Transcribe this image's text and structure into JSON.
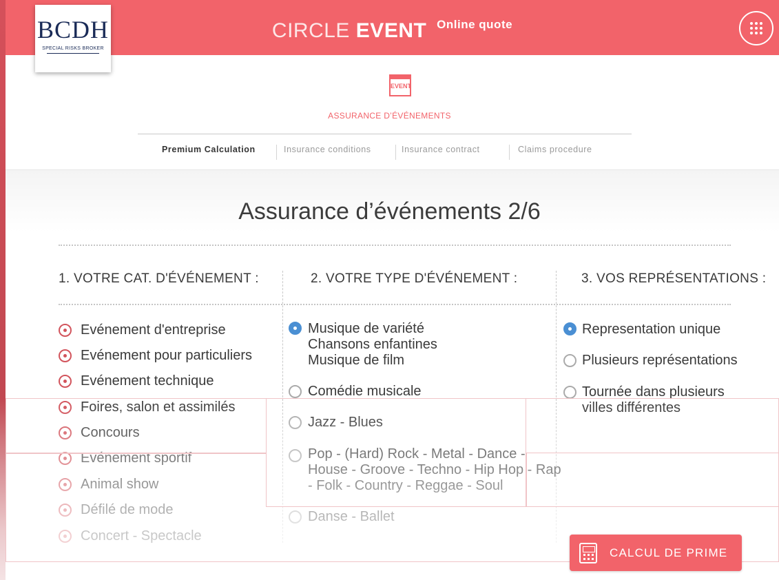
{
  "header": {
    "title_light": "CIRCLE",
    "title_bold": "EVENT",
    "subtitle": "Online quote",
    "menu_icon": "grid-dots-icon"
  },
  "logo": {
    "mark": "BCDH",
    "tagline": "SPECIAL RISKS BROKER"
  },
  "section": {
    "icon_label": "EVENT",
    "title": "ASSURANCE D’ÉVÉNEMENTS"
  },
  "nav": {
    "tabs": [
      {
        "label": "Premium Calculation",
        "active": true
      },
      {
        "label": "Insurance conditions",
        "active": false
      },
      {
        "label": "Insurance contract",
        "active": false
      },
      {
        "label": "Claims procedure",
        "active": false
      }
    ]
  },
  "page": {
    "title": "Assurance d’événements 2/6"
  },
  "columns": {
    "category": {
      "heading": "1. VOTRE CAT. D'ÉVÉNEMENT :",
      "options": [
        "Evénement d'entreprise",
        "Evénement pour particuliers",
        "Evénement technique",
        "Foires, salon et assimilés",
        "Concours",
        "Evénement sportif",
        "Animal show",
        "Défilé de mode",
        "Concert - Spectacle"
      ]
    },
    "type": {
      "heading": "2. VOTRE  TYPE D'ÉVÉNEMENT :",
      "options": [
        {
          "lines": [
            "Musique de variété",
            "Chansons enfantines",
            "Musique de film"
          ],
          "selected": true
        },
        {
          "lines": [
            "Comédie musicale"
          ],
          "selected": false
        },
        {
          "lines": [
            "Jazz - Blues"
          ],
          "selected": false
        },
        {
          "lines": [
            "Pop - (Hard) Rock - Metal - Dance -",
            "House - Groove - Techno - Hip Hop - Rap",
            "- Folk - Country - Reggae - Soul"
          ],
          "selected": false
        },
        {
          "lines": [
            "Danse - Ballet"
          ],
          "selected": false
        }
      ]
    },
    "representations": {
      "heading": "3. VOS REPRÉSENTATIONS :",
      "options": [
        {
          "lines": [
            "Representation unique"
          ],
          "selected": true
        },
        {
          "lines": [
            "Plusieurs représentations"
          ],
          "selected": false
        },
        {
          "lines": [
            "Tournée dans plusieurs",
            "villes différentes"
          ],
          "selected": false
        }
      ]
    }
  },
  "actions": {
    "calc_label": "CALCUL DE PRIME",
    "calc_icon": "calculator-icon"
  },
  "colors": {
    "brand": "#f2636a",
    "selected_radio": "#4a8fd3",
    "category_radio": "#d2545c",
    "logo_navy": "#1a2b57"
  }
}
